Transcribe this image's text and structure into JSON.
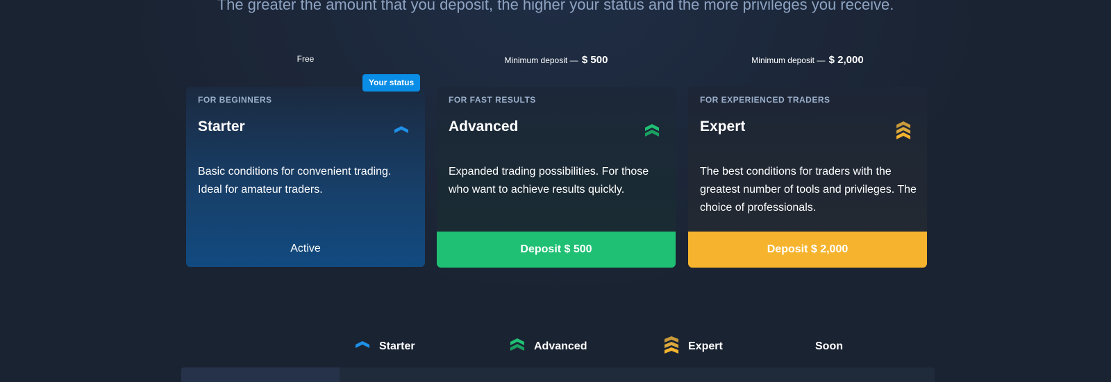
{
  "intro": {
    "subtitle": "The greater the amount that you deposit, the higher your status and the more privileges you receive."
  },
  "status_badge": "Your status",
  "plans": [
    {
      "deposit_label": "Free",
      "deposit_amount": "",
      "eyebrow": "FOR BEGINNERS",
      "name": "Starter",
      "icon": "starter-rank-icon",
      "description": "Basic conditions for convenient trading. Ideal for amateur traders.",
      "action": "Active",
      "color": "#1e90e8"
    },
    {
      "deposit_label": "Minimum deposit —",
      "deposit_amount": "$ 500",
      "eyebrow": "FOR FAST RESULTS",
      "name": "Advanced",
      "icon": "advanced-rank-icon",
      "description": "Expanded trading possibilities. For those who want to achieve results quickly.",
      "action": "Deposit $ 500",
      "color": "#20c074"
    },
    {
      "deposit_label": "Minimum deposit —",
      "deposit_amount": "$ 2,000",
      "eyebrow": "FOR EXPERIENCED TRADERS",
      "name": "Expert",
      "icon": "expert-rank-icon",
      "description": "The best conditions for traders with the greatest number of tools and privileges. The choice of professionals.",
      "action": "Deposit $ 2,000",
      "color": "#f6b42e"
    }
  ],
  "comparison_tabs": [
    {
      "label": "Starter",
      "icon": "starter-rank-icon"
    },
    {
      "label": "Advanced",
      "icon": "advanced-rank-icon"
    },
    {
      "label": "Expert",
      "icon": "expert-rank-icon"
    },
    {
      "label": "Soon",
      "icon": ""
    }
  ]
}
